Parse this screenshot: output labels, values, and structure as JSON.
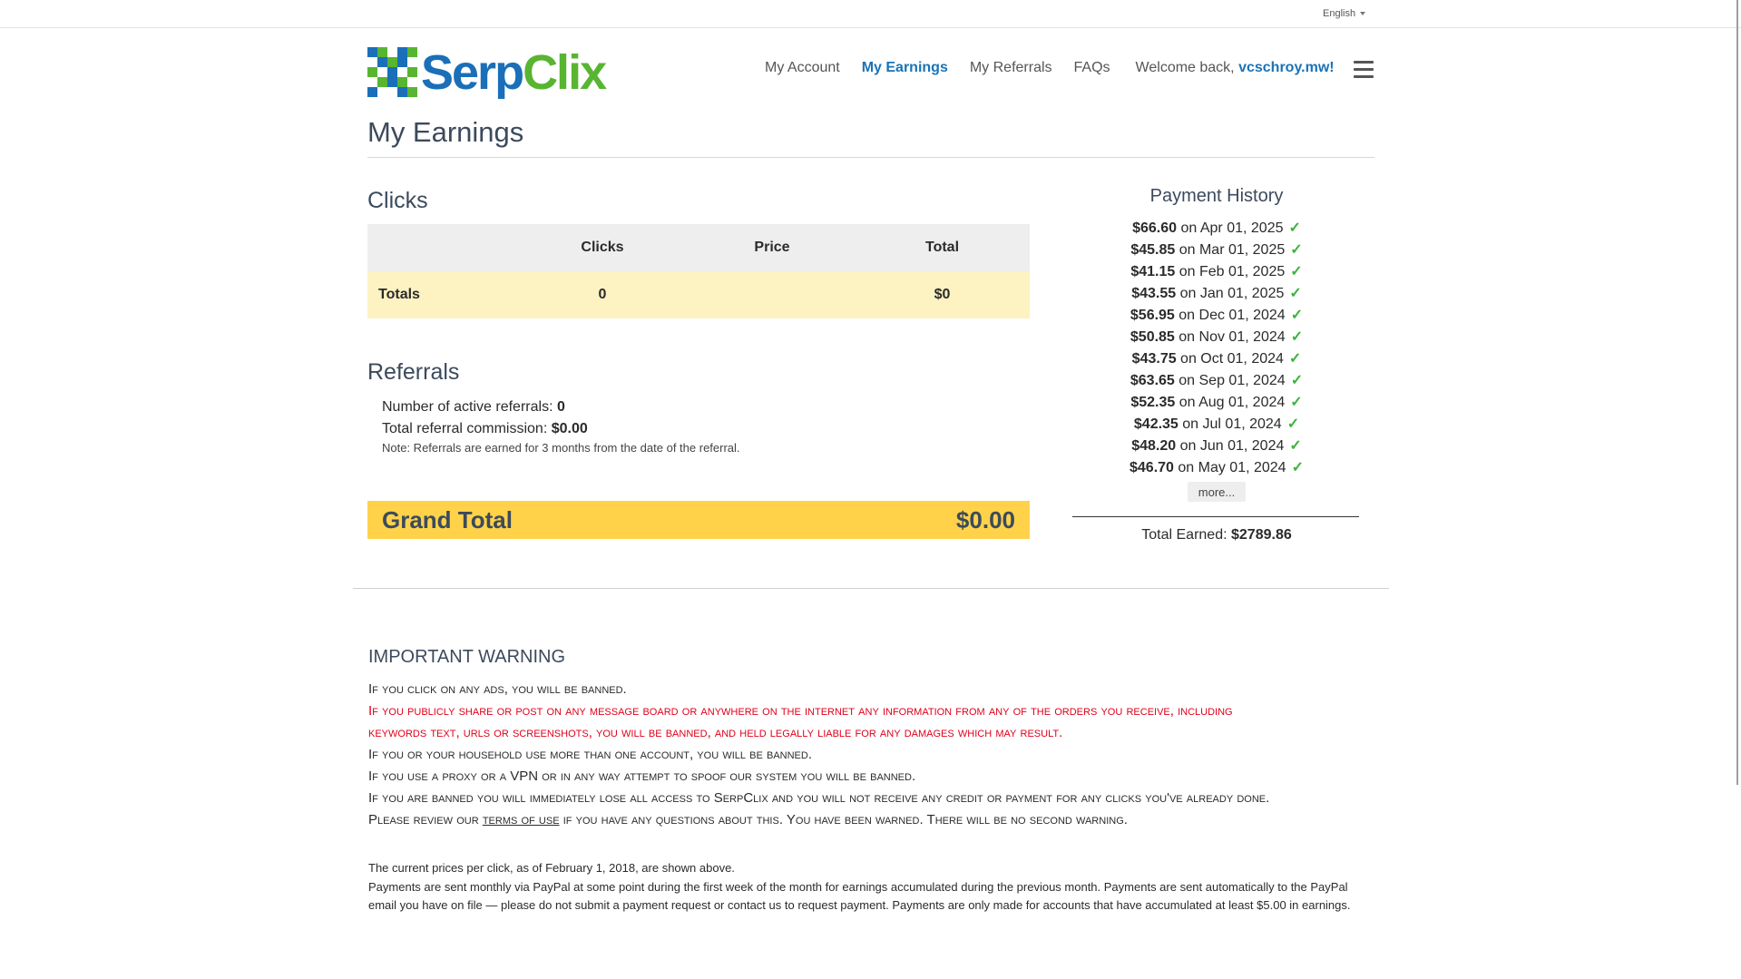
{
  "language": {
    "label": "English"
  },
  "logo": {
    "text_serp": "Serp",
    "text_clix": "Clix"
  },
  "nav": {
    "items": [
      {
        "label": "My Account",
        "active": false
      },
      {
        "label": "My Earnings",
        "active": true
      },
      {
        "label": "My Referrals",
        "active": false
      },
      {
        "label": "FAQs",
        "active": false
      }
    ],
    "welcome_prefix": "Welcome back, ",
    "username": "vcschroy.mw",
    "welcome_suffix": "!"
  },
  "page_title": "My Earnings",
  "clicks": {
    "title": "Clicks",
    "headers": [
      "",
      "Clicks",
      "Price",
      "Total"
    ],
    "totals_row": [
      "Totals",
      "0",
      "",
      "$0"
    ]
  },
  "referrals": {
    "title": "Referrals",
    "active_label": "Number of active referrals: ",
    "active_value": "0",
    "commission_label": "Total referral commission: ",
    "commission_value": "$0.00",
    "note": "Note: Referrals are earned for 3 months from the date of the referral."
  },
  "grand_total": {
    "label": "Grand Total",
    "value": "$0.00"
  },
  "payment_history": {
    "title": "Payment History",
    "on": " on ",
    "check": "✓",
    "entries": [
      {
        "amount": "$66.60",
        "date": "Apr 01, 2025"
      },
      {
        "amount": "$45.85",
        "date": "Mar 01, 2025"
      },
      {
        "amount": "$41.15",
        "date": "Feb 01, 2025"
      },
      {
        "amount": "$43.55",
        "date": "Jan 01, 2025"
      },
      {
        "amount": "$56.95",
        "date": "Dec 01, 2024"
      },
      {
        "amount": "$50.85",
        "date": "Nov 01, 2024"
      },
      {
        "amount": "$43.75",
        "date": "Oct 01, 2024"
      },
      {
        "amount": "$63.65",
        "date": "Sep 01, 2024"
      },
      {
        "amount": "$52.35",
        "date": "Aug 01, 2024"
      },
      {
        "amount": "$42.35",
        "date": "Jul 01, 2024"
      },
      {
        "amount": "$48.20",
        "date": "Jun 01, 2024"
      },
      {
        "amount": "$46.70",
        "date": "May 01, 2024"
      }
    ],
    "more_label": "more...",
    "total_label": "Total Earned: ",
    "total_value": "$2789.86"
  },
  "warning": {
    "title": "IMPORTANT WARNING",
    "line1": "If you click on any ads, you will be banned.",
    "line2a": "If you publicly share or post on any message board or anywhere on the internet any information from any of the orders you receive, including",
    "line2b": "keywords text, urls or screenshots, you will be banned, and held legally liable for any damages which may result.",
    "line3": "If you or your household use more than one account, you will be banned.",
    "line4": "If you use a proxy or a VPN or in any way attempt to spoof our system you will be banned.",
    "line5": "If you are banned you will immediately lose all access to SerpClix and you will not receive any credit or payment for any clicks you've already done.",
    "line6_prefix": "Please review our ",
    "line6_link": "terms of use",
    "line6_suffix": " if you have any questions about this. You have been warned. There will be no second warning."
  },
  "footer": {
    "prices_note": "The current prices per click, as of February 1, 2018, are shown above.",
    "payments_note": "Payments are sent monthly via PayPal at some point during the first week of the month for earnings accumulated during the previous month. Payments are sent automatically to the PayPal email you have on file — please do not submit a payment request or contact us to request payment. Payments are only made for accounts that have accumulated at least $5.00 in earnings."
  },
  "colors": {
    "brand_blue": "#1a73b7",
    "brand_green": "#58b531",
    "grand_total_bg": "#ffd24a",
    "warning_red": "#e0001b",
    "check_green": "#3cb43c"
  },
  "icons": {
    "menu": "hamburger-icon",
    "check": "check-icon",
    "caret": "caret-down-icon",
    "logo": "serpclix-logo-mark"
  }
}
